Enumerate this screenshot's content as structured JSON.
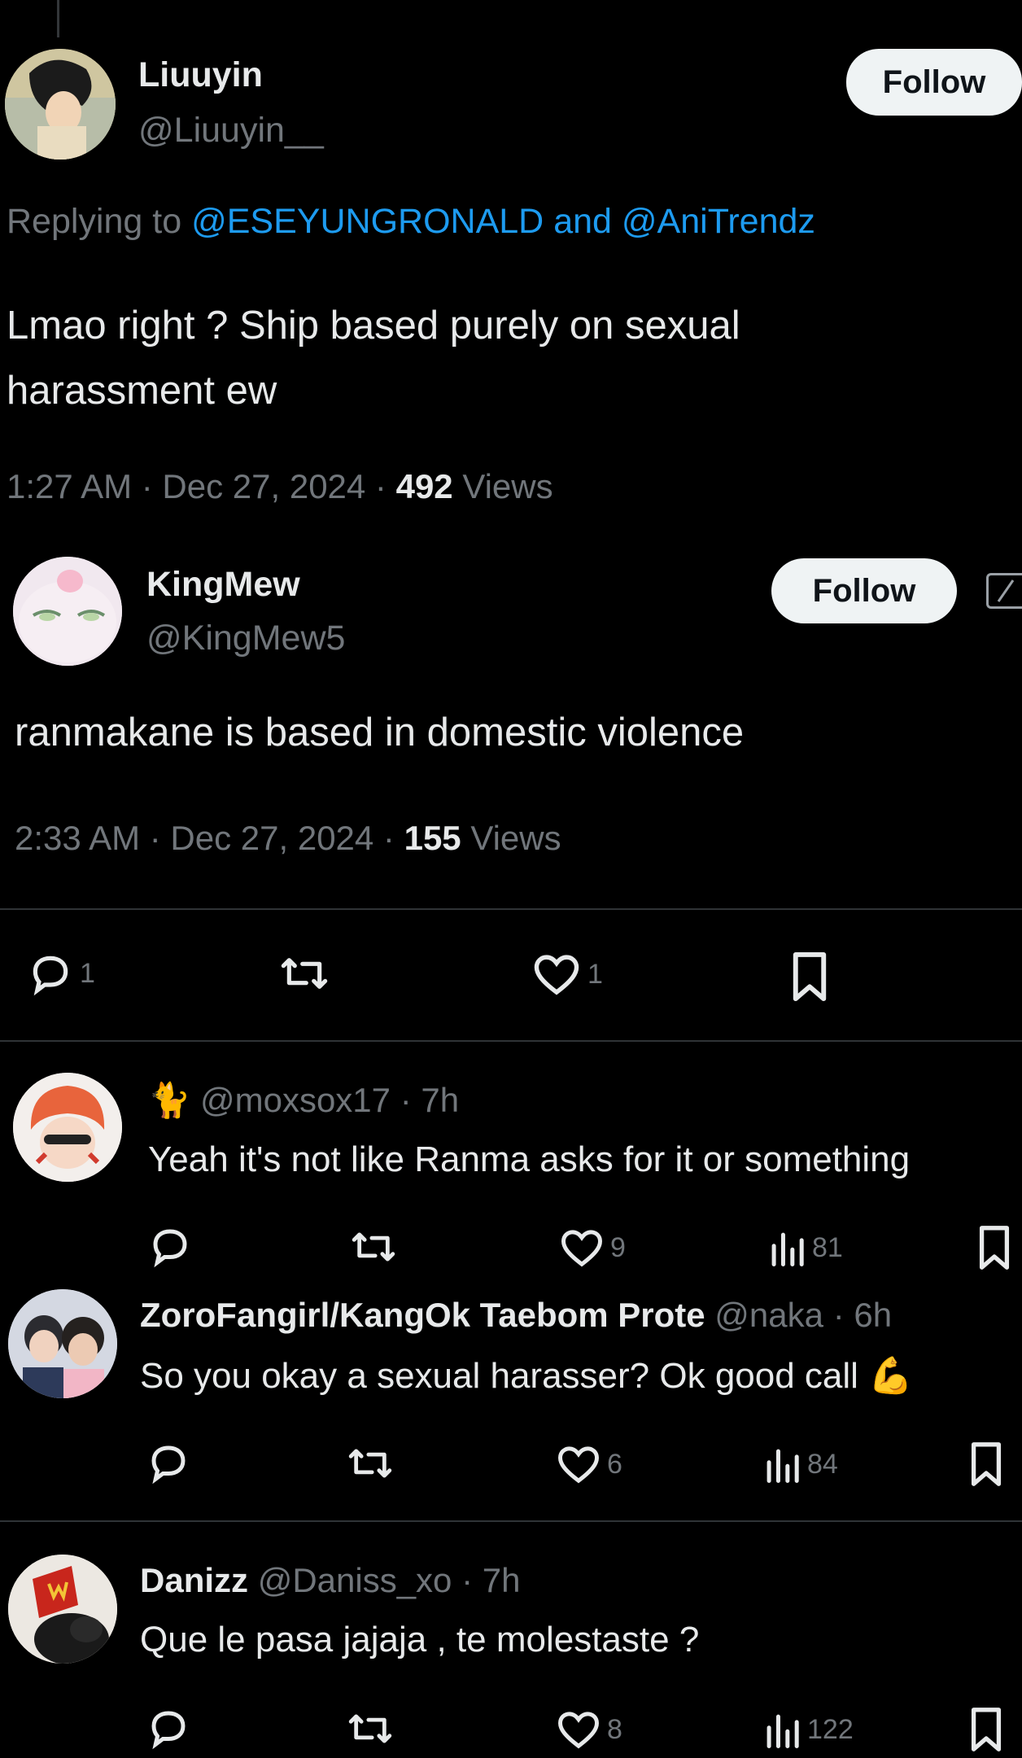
{
  "tweet1": {
    "name": "Liuuyin",
    "handle": "@Liuuyin__",
    "follow_label": "Follow",
    "replying_prefix": "Replying to",
    "reply_to_1": "@ESEYUNGRONALD",
    "reply_and": "and",
    "reply_to_2": "@AniTrendz",
    "text_line1": "Lmao right ? Ship based purely on sexual",
    "text_line2": "harassment ew",
    "timestamp": "1:27 AM · Dec 27, 2024 · ",
    "views_count": "492",
    "views_label": "Views"
  },
  "tweet2": {
    "name": "KingMew",
    "handle": "@KingMew5",
    "follow_label": "Follow",
    "text": "ranmakane is based in domestic violence",
    "timestamp": "2:33 AM · Dec 27, 2024 · ",
    "views_count": "155",
    "views_label": "Views",
    "replies": "1",
    "likes": "1"
  },
  "replies": [
    {
      "emoji": "🐈",
      "handle": "@moxsox17",
      "time": "· 7h",
      "text": "Yeah it's not like Ranma asks for it or something",
      "likes": "9",
      "views": "81"
    },
    {
      "name": "ZoroFangirl/KangOk Taebom Prote",
      "handle": "@naka",
      "time": "· 6h",
      "text": "So you okay a sexual harasser? Ok good call",
      "emoji": "💪",
      "likes": "6",
      "views": "84"
    },
    {
      "name": "Danizz",
      "handle": "@Daniss_xo",
      "time": "· 7h",
      "text": "Que le pasa jajaja , te molestaste ?",
      "likes": "8",
      "views": "122"
    }
  ],
  "colors": {
    "background": "#000000",
    "text": "#e7e9ea",
    "muted": "#71767b",
    "link": "#1d9bf0",
    "button_bg": "#eff3f4"
  }
}
